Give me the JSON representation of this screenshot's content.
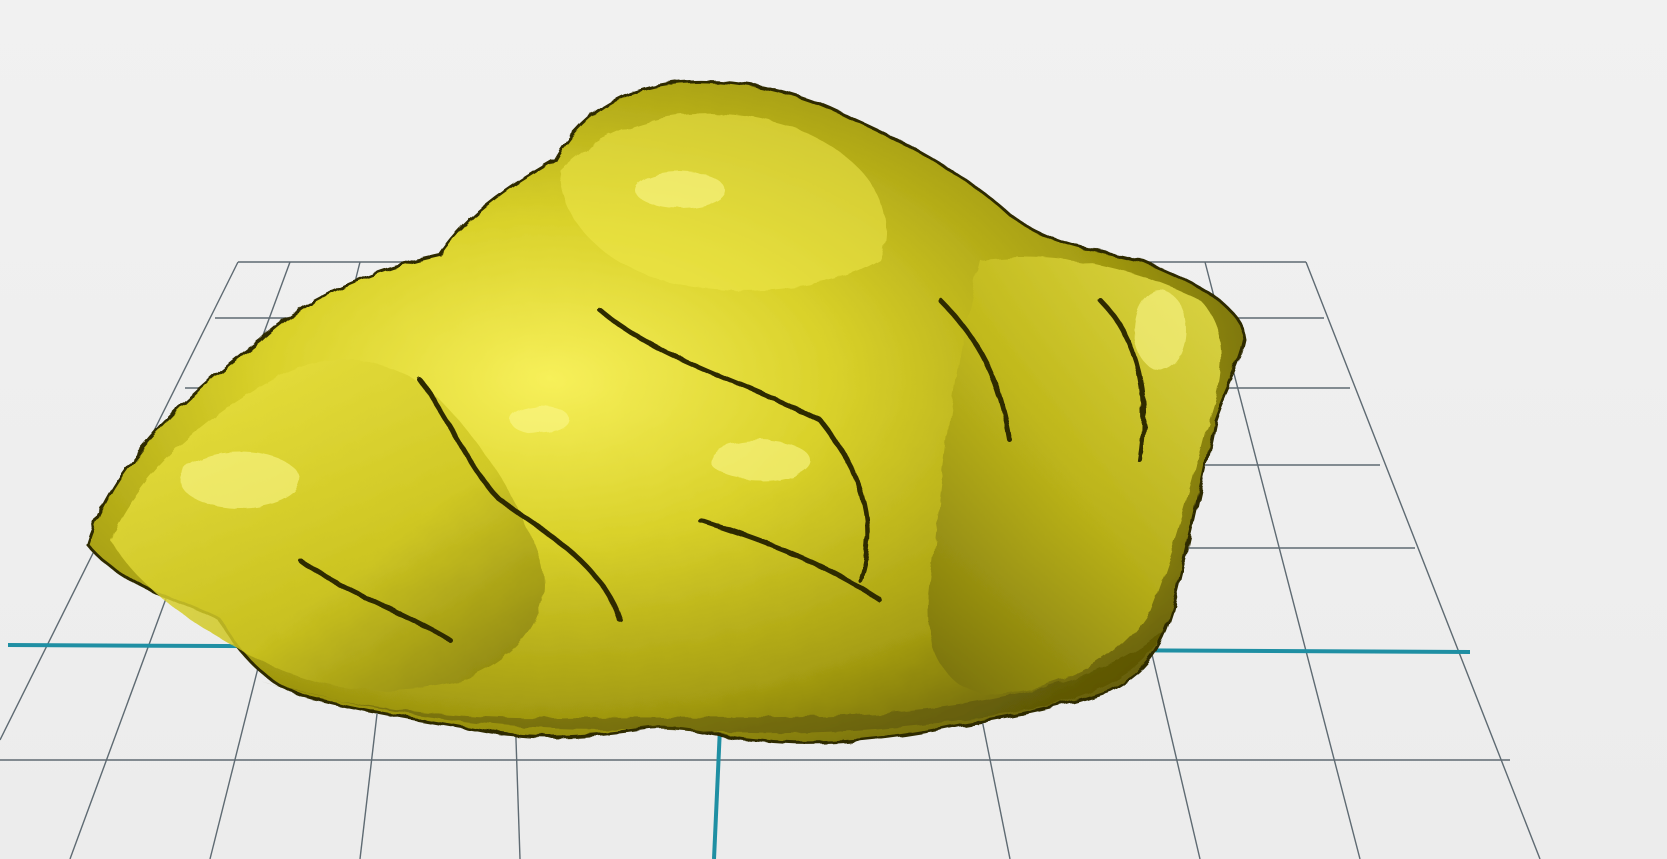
{
  "viewport": {
    "background_color": "#ececec",
    "grid_line_color": "#5e6a72",
    "axis_color": "#1f8fa3",
    "model": {
      "name": "gold-nugget-mesh",
      "base_color": "#c9c21c",
      "highlight_color": "#f4ee4a",
      "shadow_color": "#3d3904"
    }
  }
}
